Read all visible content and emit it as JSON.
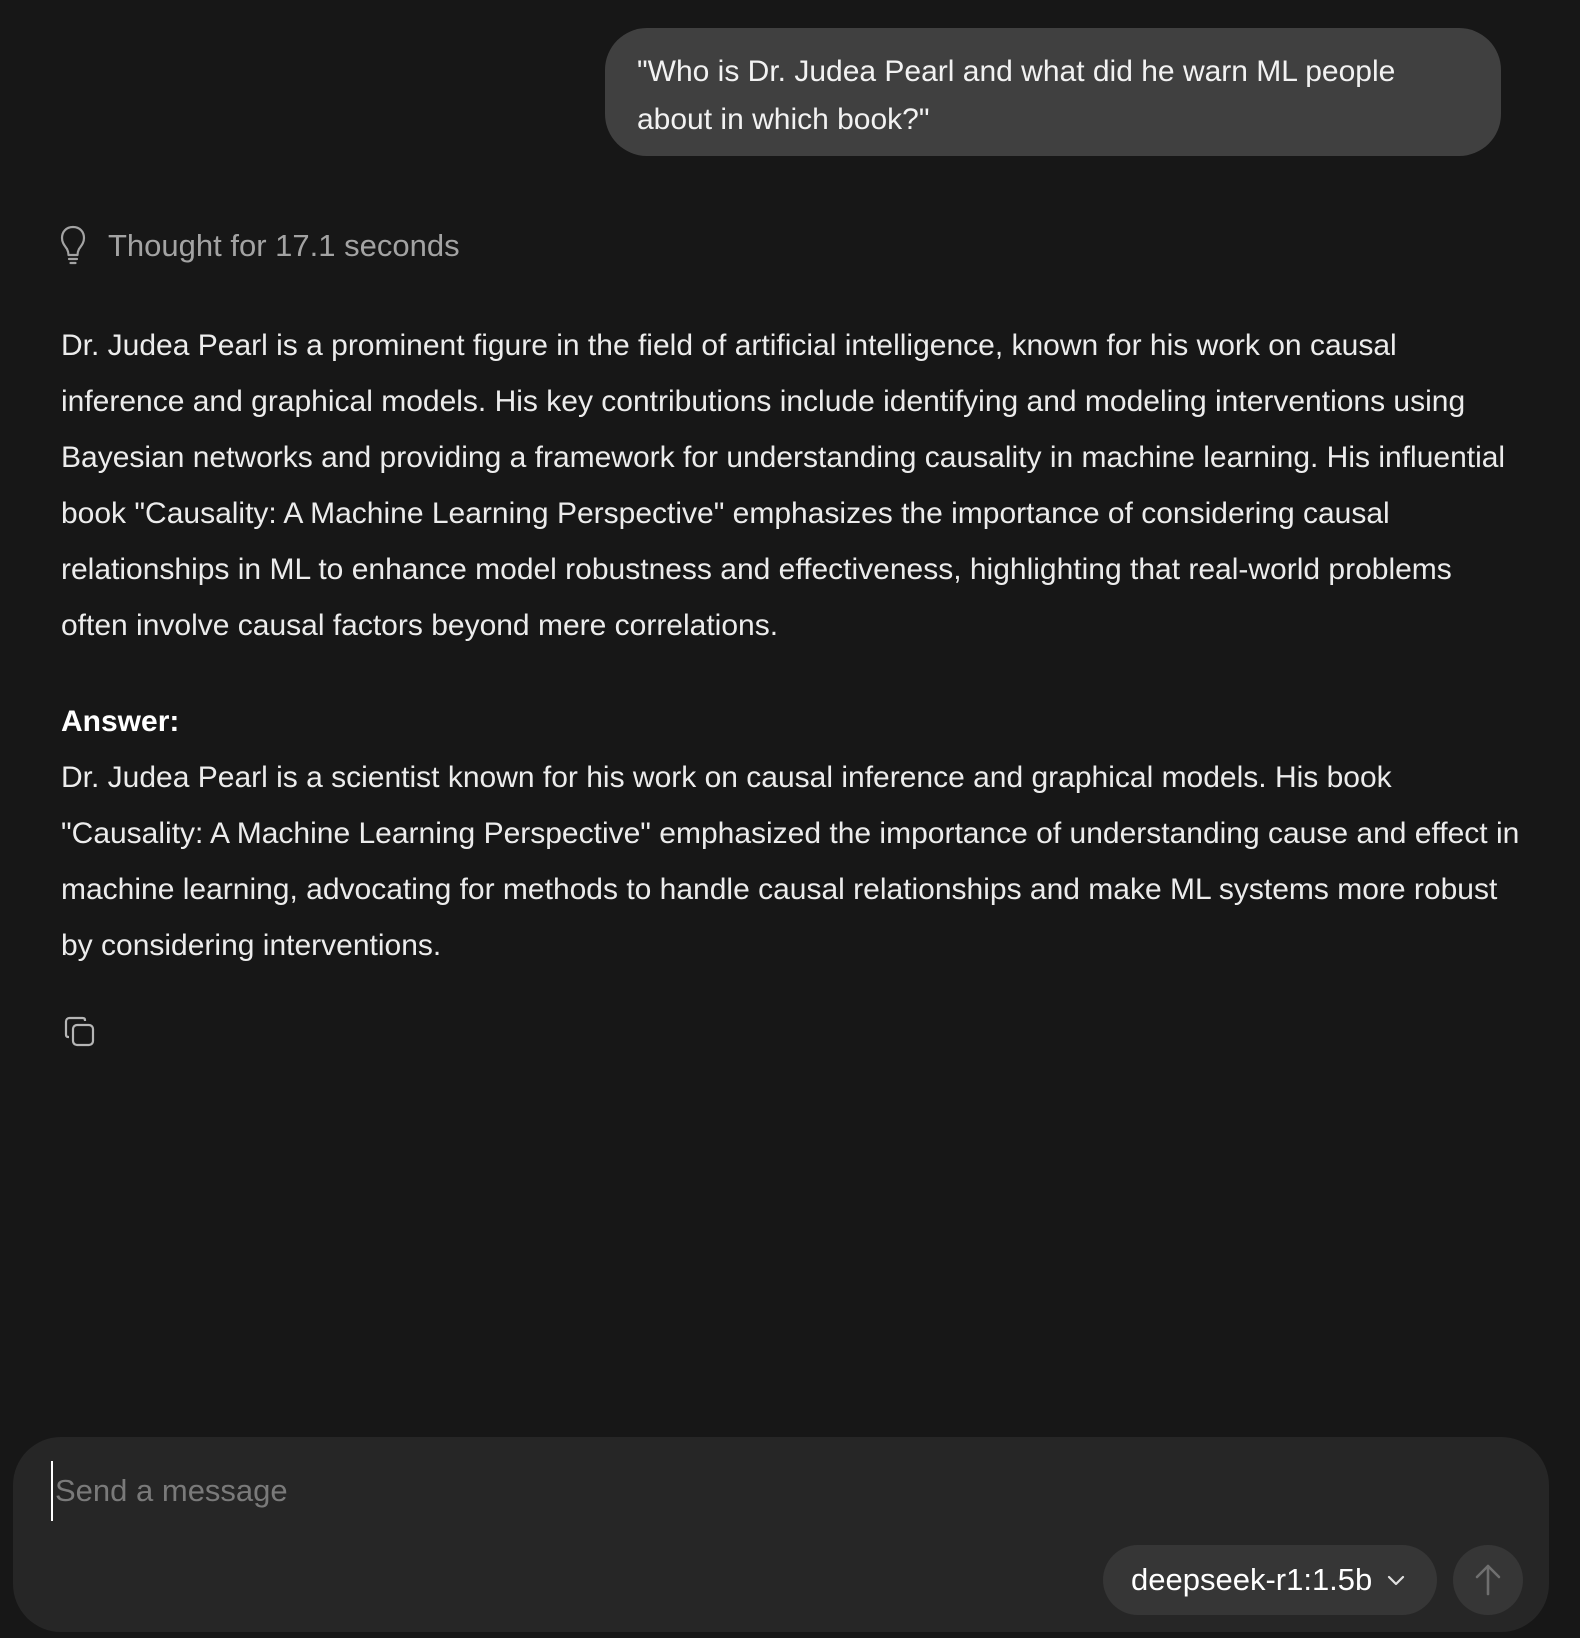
{
  "conversation": {
    "user_message": "\"Who is Dr. Judea Pearl and what did he warn ML people about in which book?\"",
    "thought_label": "Thought for 17.1 seconds",
    "response_paragraph": "Dr. Judea Pearl is a prominent figure in the field of artificial intelligence, known for his work on causal inference and graphical models. His key contributions include identifying and modeling interventions using Bayesian networks and providing a framework for understanding causality in machine learning. His influential book \"Causality: A Machine Learning Perspective\" emphasizes the importance of considering causal relationships in ML to enhance model robustness and effectiveness, highlighting that real-world problems often involve causal factors beyond mere correlations.",
    "answer_heading": "Answer:",
    "answer_text": "Dr. Judea Pearl is a scientist known for his work on causal inference and graphical models. His book \"Causality: A Machine Learning Perspective\" emphasized the importance of understanding cause and effect in machine learning, advocating for methods to handle causal relationships and make ML systems more robust by considering interventions."
  },
  "icons": {
    "thought": "lightbulb-icon",
    "copy": "copy-icon",
    "model_dropdown": "chevron-down-icon",
    "send": "arrow-up-icon"
  },
  "composer": {
    "placeholder": "Send a message",
    "value": "",
    "model": "deepseek-r1:1.5b"
  },
  "colors": {
    "background": "#171717",
    "user_bubble": "#404040",
    "composer": "#262626",
    "pill": "#363636",
    "muted_text": "#a3a3a3"
  }
}
